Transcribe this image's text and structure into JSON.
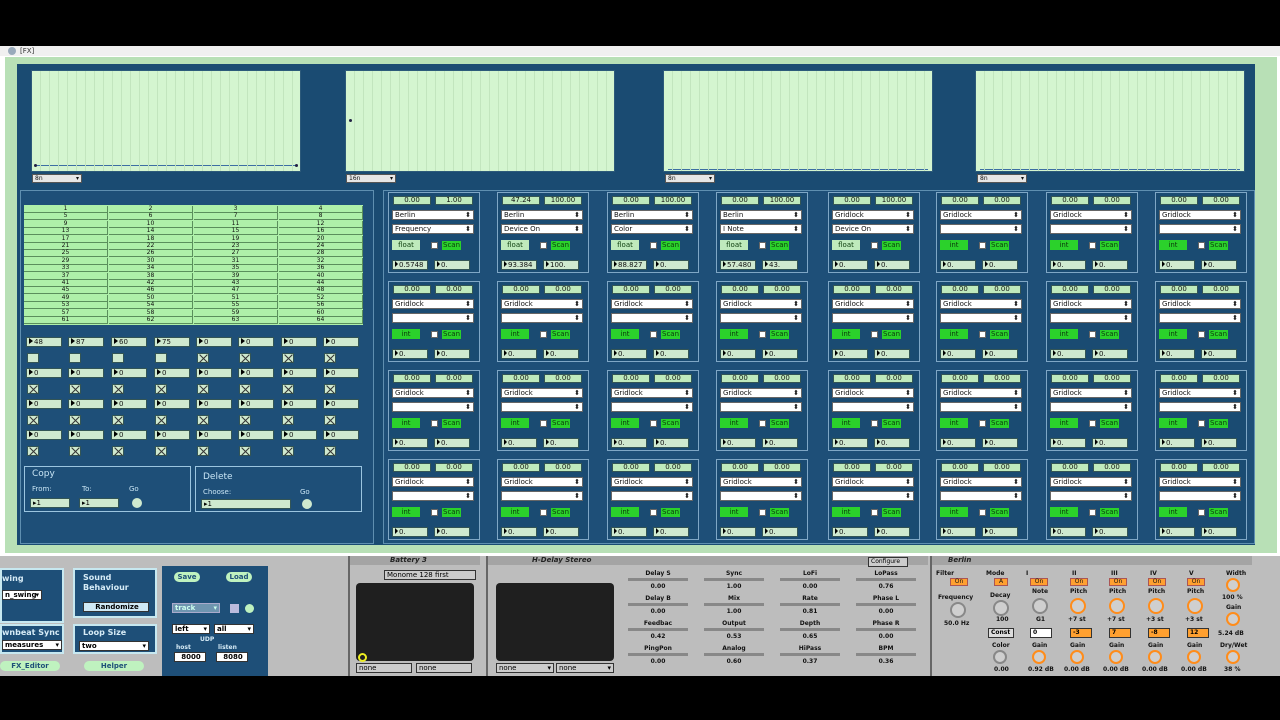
{
  "window": {
    "title": "[FX]"
  },
  "plotters": [
    {
      "rate": "8n"
    },
    {
      "rate": "16n"
    },
    {
      "rate": "8n"
    },
    {
      "rate": "8n"
    }
  ],
  "grid64": {
    "rows": [
      [
        "1",
        "2",
        "3",
        "4"
      ],
      [
        "5",
        "6",
        "7",
        "8"
      ],
      [
        "9",
        "10",
        "11",
        "12"
      ],
      [
        "13",
        "14",
        "15",
        "16"
      ],
      [
        "17",
        "18",
        "19",
        "20"
      ],
      [
        "21",
        "22",
        "23",
        "24"
      ],
      [
        "25",
        "26",
        "27",
        "28"
      ],
      [
        "29",
        "30",
        "31",
        "32"
      ],
      [
        "33",
        "34",
        "35",
        "36"
      ],
      [
        "37",
        "38",
        "39",
        "40"
      ],
      [
        "41",
        "42",
        "43",
        "44"
      ],
      [
        "45",
        "46",
        "47",
        "48"
      ],
      [
        "49",
        "50",
        "51",
        "52"
      ],
      [
        "53",
        "54",
        "55",
        "56"
      ],
      [
        "57",
        "58",
        "59",
        "60"
      ],
      [
        "61",
        "62",
        "63",
        "64"
      ]
    ]
  },
  "matrix_row1": [
    "48",
    "87",
    "60",
    "75",
    "0",
    "0",
    "0",
    "0"
  ],
  "matrix_zero": "0",
  "copy": {
    "title": "Copy",
    "from_label": "From:",
    "to_label": "To:",
    "go_label": "Go",
    "from_value": "1",
    "to_value": "1"
  },
  "delete": {
    "title": "Delete",
    "choose_label": "Choose:",
    "go_label": "Go",
    "choose_value": "1"
  },
  "modules": [
    {
      "lo": "0.00",
      "hi": "1.00",
      "src": "Berlin",
      "param": "Frequency",
      "mode": "float",
      "scan": "Scan",
      "v1": "0.5748",
      "v2": "0."
    },
    {
      "lo": "47.24",
      "hi": "100.00",
      "src": "Berlin",
      "param": "Device On",
      "mode": "float",
      "scan": "Scan",
      "v1": "93.384",
      "v2": "100."
    },
    {
      "lo": "0.00",
      "hi": "100.00",
      "src": "Berlin",
      "param": "Color",
      "mode": "float",
      "scan": "Scan",
      "v1": "88.827",
      "v2": "0."
    },
    {
      "lo": "0.00",
      "hi": "100.00",
      "src": "Berlin",
      "param": "I Note",
      "mode": "float",
      "scan": "Scan",
      "v1": "57.480",
      "v2": "43."
    },
    {
      "lo": "0.00",
      "hi": "100.00",
      "src": "Gridlock",
      "param": "Device On",
      "mode": "float",
      "scan": "Scan",
      "v1": "0.",
      "v2": "0."
    },
    {
      "lo": "0.00",
      "hi": "0.00",
      "src": "Gridlock",
      "param": "",
      "mode": "int",
      "scan": "Scan",
      "v1": "0.",
      "v2": "0."
    },
    {
      "lo": "0.00",
      "hi": "0.00",
      "src": "Gridlock",
      "param": "",
      "mode": "int",
      "scan": "Scan",
      "v1": "0.",
      "v2": "0."
    },
    {
      "lo": "0.00",
      "hi": "0.00",
      "src": "Gridlock",
      "param": "",
      "mode": "int",
      "scan": "Scan",
      "v1": "0.",
      "v2": "0."
    }
  ],
  "module_default": {
    "lo": "0.00",
    "hi": "0.00",
    "src": "Gridlock",
    "mode": "int",
    "scan": "Scan",
    "v1": "0.",
    "v2": "0."
  },
  "live": {
    "left_device": {
      "swing_label": "wing",
      "swing_value": "n_swing",
      "downbeat_label": "wnbeat Sync",
      "downbeat_value": "measures",
      "fx_editor": "FX_Editor",
      "sound_label": "Sound",
      "behaviour_label": "Behaviour",
      "randomize": "Randomize",
      "loop_size_label": "Loop Size",
      "loop_size_value": "two",
      "helper": "Helper",
      "save": "Save",
      "load": "Load",
      "track_value": "track",
      "left_value": "left",
      "all_value": "all",
      "udp_label": "UDP",
      "host_label": "host",
      "listen_label": "listen",
      "host_value": "8000",
      "listen_value": "8080"
    },
    "battery": {
      "title": "Battery 3",
      "preset": "Monome 128 first",
      "none1": "none",
      "none2": "none"
    },
    "hdelay": {
      "title": "H-Delay Stereo",
      "configure": "Configure",
      "none1": "none",
      "none2": "none",
      "params": [
        {
          "label": "Delay S",
          "value": "0.00"
        },
        {
          "label": "Sync",
          "value": "1.00"
        },
        {
          "label": "LoFi",
          "value": "0.00"
        },
        {
          "label": "LoPass",
          "value": "0.76"
        },
        {
          "label": "Delay B",
          "value": "0.00"
        },
        {
          "label": "Mix",
          "value": "1.00"
        },
        {
          "label": "Rate",
          "value": "0.81"
        },
        {
          "label": "Phase L",
          "value": "0.00"
        },
        {
          "label": "Feedbac",
          "value": "0.42"
        },
        {
          "label": "Output",
          "value": "0.53"
        },
        {
          "label": "Depth",
          "value": "0.65"
        },
        {
          "label": "Phase R",
          "value": "0.00"
        },
        {
          "label": "PingPon",
          "value": "0.00"
        },
        {
          "label": "Analog",
          "value": "0.60"
        },
        {
          "label": "HiPass",
          "value": "0.37"
        },
        {
          "label": "BPM",
          "value": "0.36"
        }
      ]
    },
    "berlin": {
      "title": "Berlin",
      "filter": "Filter",
      "mode": "Mode",
      "on": "On",
      "a": "A",
      "frequency": "Frequency",
      "freq_value": "50.0 Hz",
      "decay": "Decay",
      "decay_value": "100",
      "note": "Note",
      "note_value": "G1",
      "const": "Const",
      "const_value": "0",
      "color": "Color",
      "color_value": "0.00",
      "gain_label": "Gain",
      "pitch_label": "Pitch",
      "voices": [
        {
          "label": "II",
          "pitch": "+7 st",
          "offset": "-3",
          "gain": "0.00 dB"
        },
        {
          "label": "III",
          "pitch": "+7 st",
          "offset": "7",
          "gain": "0.00 dB"
        },
        {
          "label": "IV",
          "pitch": "+3 st",
          "offset": "-8",
          "gain": "0.00 dB"
        },
        {
          "label": "V",
          "pitch": "+3 st",
          "offset": "12",
          "gain": "0.00 dB"
        }
      ],
      "voice1_label": "I",
      "voice1_gain": "0.92 dB",
      "width": "Width",
      "width_value": "100 %",
      "gain_out": "5.24 dB",
      "drywet": "Dry/Wet",
      "drywet_value": "38 %"
    }
  }
}
